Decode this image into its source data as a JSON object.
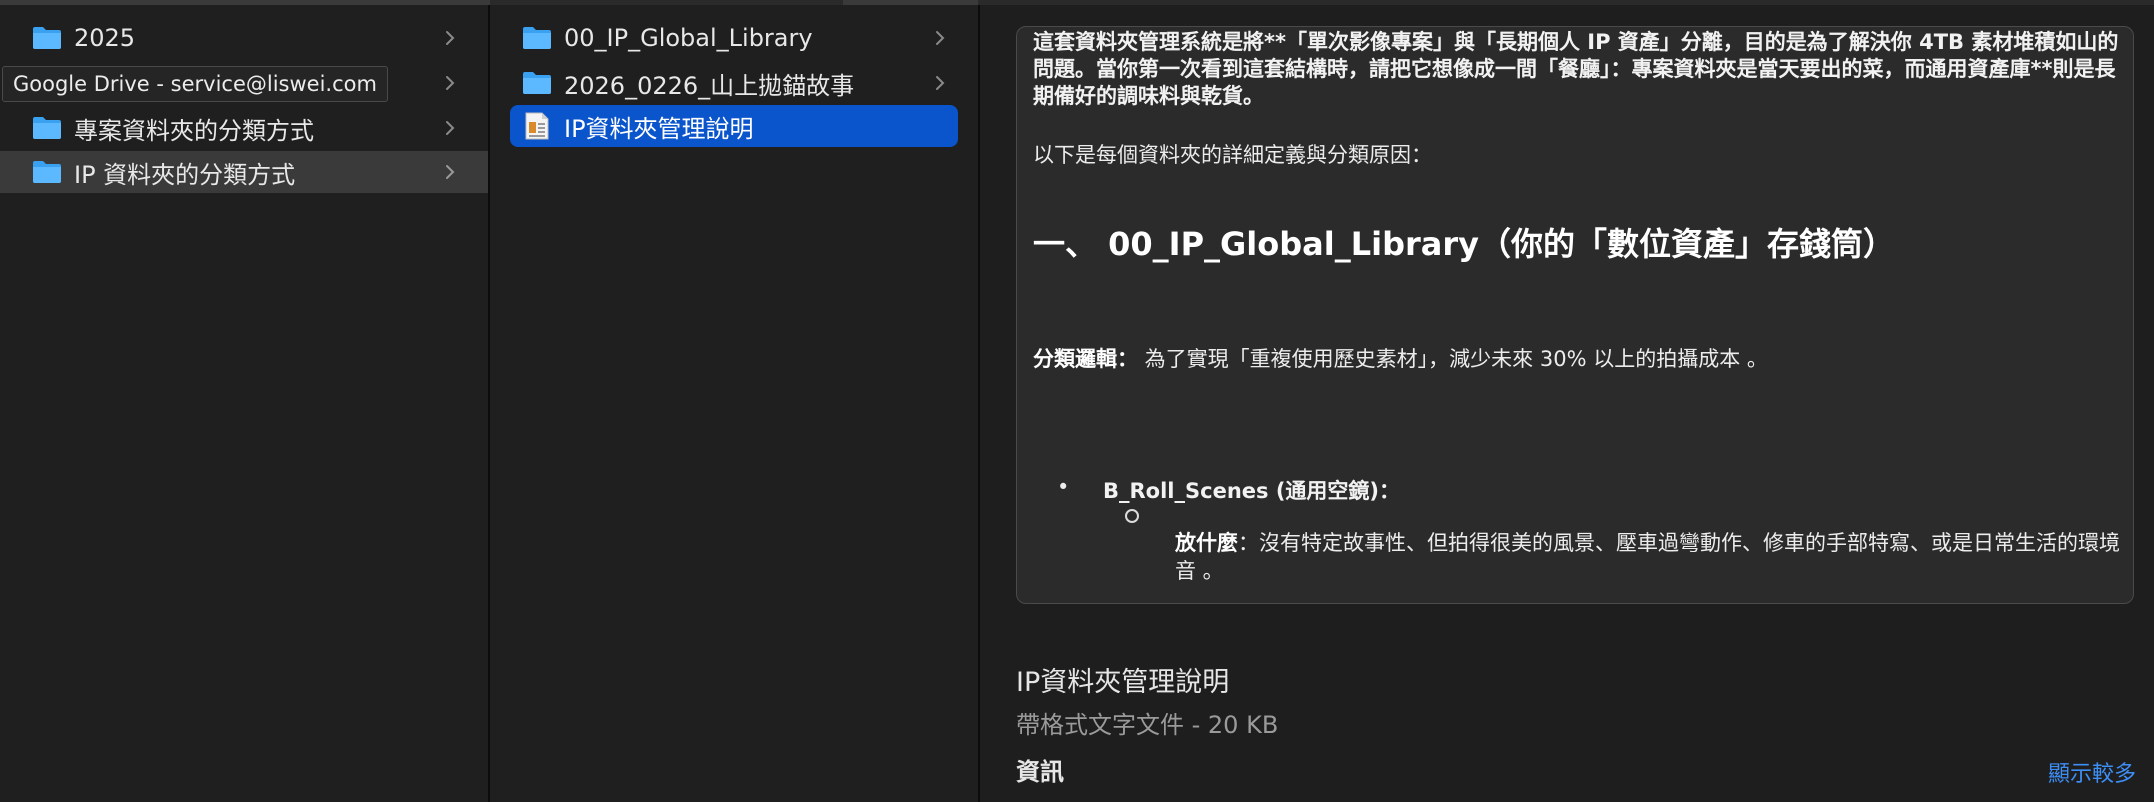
{
  "tooltip": "Google Drive - service@liswei.com",
  "column1": {
    "items": [
      {
        "label": "2025"
      },
      {
        "label": ""
      },
      {
        "label": "專案資料夾的分類方式"
      },
      {
        "label": "IP 資料夾的分類方式"
      }
    ]
  },
  "column2": {
    "items": [
      {
        "label": "00_IP_Global_Library"
      },
      {
        "label": "2026_0226_山上拋錨故事"
      },
      {
        "label": "IP資料夾管理說明"
      }
    ]
  },
  "preview": {
    "intro": "這套資料夾管理系統是將**「單次影像專案」與「長期個人 IP 資產」分離，目的是為了解決你 4TB 素材堆積如山的問題。當你第一次看到這套結構時，請把它想像成一間「餐廳」：專案資料夾是當天要出的菜，而通用資產庫**則是長期備好的調味料與乾貨。",
    "line2": "以下是每個資料夾的詳細定義與分類原因：",
    "heading": "一、 00_IP_Global_Library（你的「數位資產」存錢筒）",
    "logic_label": "分類邏輯：",
    "logic_text": " 為了實現「重複使用歷史素材」，減少未來 30% 以上的拍攝成本 。",
    "bullet_mark": "•",
    "bullet_text": "B_Roll_Scenes (通用空鏡)：",
    "sub_label": "放什麼",
    "sub_text": "：沒有特定故事性、但拍得很美的風景、壓車過彎動作、修車的手部特寫、或是日常生活的環境音 。"
  },
  "info": {
    "title": "IP資料夾管理說明",
    "subtitle": "帶格式文字文件 - 20 KB",
    "section": "資訊",
    "show_more": "顯示較多"
  },
  "colors": {
    "folder": "#3aa0f0",
    "selection": "#0a54cc",
    "link": "#3d8ef5"
  }
}
